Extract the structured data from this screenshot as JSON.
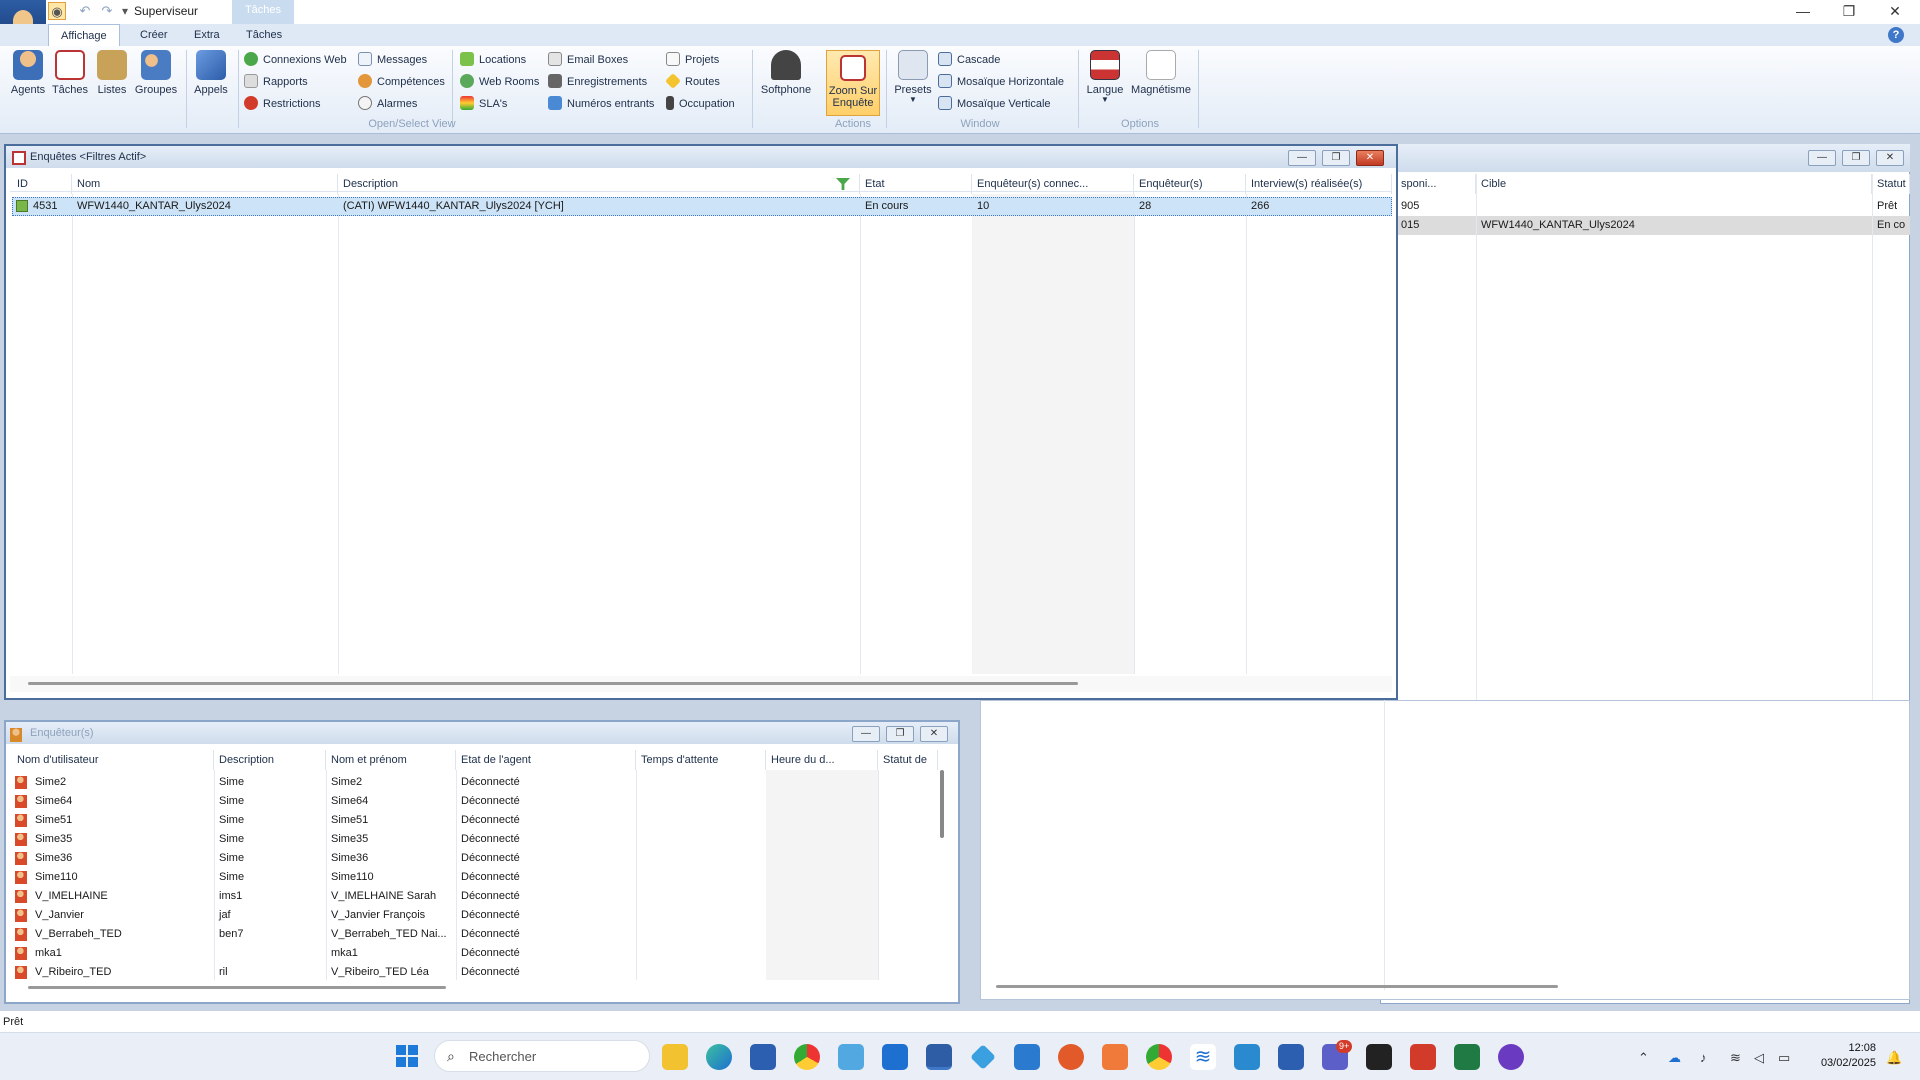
{
  "app": {
    "title": "Superviseur",
    "context_tab": "Tâches"
  },
  "window_controls": {
    "minimize": "—",
    "restore": "❐",
    "close": "✕"
  },
  "ribbon_tabs": [
    {
      "label": "Affichage",
      "active": true
    },
    {
      "label": "Créer",
      "active": false
    },
    {
      "label": "Extra",
      "active": false
    },
    {
      "label": "Tâches",
      "active": false
    }
  ],
  "ribbon": {
    "big_buttons": {
      "agents": "Agents",
      "taches": "Tâches",
      "listes": "Listes",
      "groupes": "Groupes",
      "appels": "Appels",
      "softphone": "Softphone",
      "zoom": "Zoom Sur\nEnquête",
      "presets": "Presets",
      "langue": "Langue",
      "magnetisme": "Magnétisme"
    },
    "col1": [
      "Connexions Web",
      "Rapports",
      "Restrictions"
    ],
    "col2": [
      "Messages",
      "Compétences",
      "Alarmes"
    ],
    "col3": [
      "Locations",
      "Web Rooms",
      "SLA's"
    ],
    "col4": [
      "Email Boxes",
      "Enregistrements",
      "Numéros entrants"
    ],
    "col5": [
      "Projets",
      "Routes",
      "Occupation"
    ],
    "window_col": [
      "Cascade",
      "Mosaïque Horizontale",
      "Mosaïque Verticale"
    ],
    "groups": {
      "open_select": "Open/Select View",
      "actions": "Actions",
      "window": "Window",
      "options": "Options"
    }
  },
  "enquetes_window": {
    "title": "Enquêtes <Filtres Actif>",
    "columns": [
      "ID",
      "Nom",
      "Description",
      "Etat",
      "Enquêteur(s) connec...",
      "Enquêteur(s)",
      "Interview(s) réalisée(s)"
    ],
    "rows": [
      {
        "id": "4531",
        "nom": "WFW1440_KANTAR_Ulys2024",
        "description": "(CATI) WFW1440_KANTAR_Ulys2024 [YCH]",
        "etat": "En cours",
        "connectes": "10",
        "enqueteurs": "28",
        "interviews": "266"
      }
    ]
  },
  "right_window": {
    "columns": [
      "sponi...",
      "Cible",
      "Statut"
    ],
    "rows": [
      {
        "col1": "905",
        "cible": "",
        "statut": "Prêt"
      },
      {
        "col1": "015",
        "cible": "WFW1440_KANTAR_Ulys2024",
        "statut": "En co"
      }
    ]
  },
  "enqueteurs_window": {
    "title": "Enquêteur(s)",
    "columns": [
      "Nom d'utilisateur",
      "Description",
      "Nom et prénom",
      "Etat de l'agent",
      "Temps d'attente",
      "Heure du d...",
      "Statut de"
    ],
    "rows": [
      {
        "user": "Sime2",
        "desc": "Sime",
        "name": "Sime2",
        "state": "Déconnecté"
      },
      {
        "user": "Sime64",
        "desc": "Sime",
        "name": "Sime64",
        "state": "Déconnecté"
      },
      {
        "user": "Sime51",
        "desc": "Sime",
        "name": "Sime51",
        "state": "Déconnecté"
      },
      {
        "user": "Sime35",
        "desc": "Sime",
        "name": "Sime35",
        "state": "Déconnecté"
      },
      {
        "user": "Sime36",
        "desc": "Sime",
        "name": "Sime36",
        "state": "Déconnecté"
      },
      {
        "user": "Sime110",
        "desc": "Sime",
        "name": "Sime110",
        "state": "Déconnecté"
      },
      {
        "user": "V_IMELHAINE",
        "desc": "ims1",
        "name": "V_IMELHAINE Sarah",
        "state": "Déconnecté"
      },
      {
        "user": "V_Janvier",
        "desc": "jaf",
        "name": "V_Janvier François",
        "state": "Déconnecté"
      },
      {
        "user": "V_Berrabeh_TED",
        "desc": "ben7",
        "name": "V_Berrabeh_TED Nai...",
        "state": "Déconnecté"
      },
      {
        "user": "mka1",
        "desc": "",
        "name": "mka1",
        "state": "Déconnecté"
      },
      {
        "user": "V_Ribeiro_TED",
        "desc": "ril",
        "name": "V_Ribeiro_TED Léa",
        "state": "Déconnecté"
      }
    ]
  },
  "status_bar": {
    "text": "Prêt"
  },
  "taskbar": {
    "search_placeholder": "Rechercher",
    "time": "12:08",
    "date": "03/02/2025",
    "teams_badge": "9+"
  },
  "colors": {
    "accent": "#3f78c8",
    "selection": "#cde3f7",
    "ribbon_bg": "#e3ecf7",
    "active_button": "#ffd88a"
  }
}
